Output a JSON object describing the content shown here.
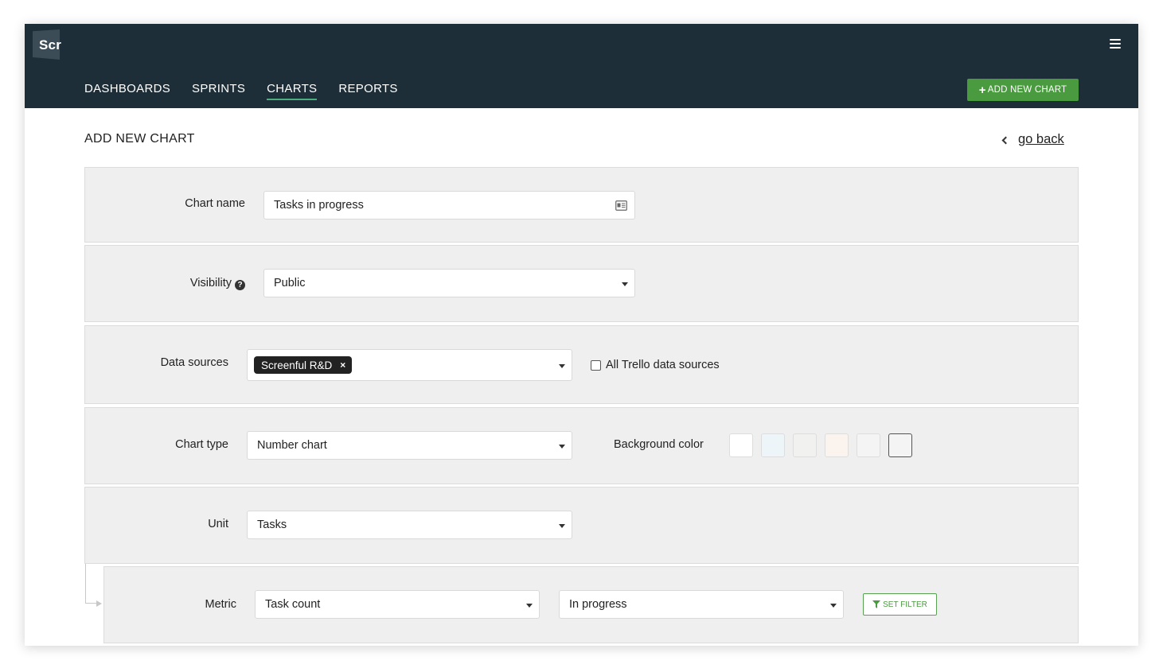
{
  "app": {
    "logo_text": "Scr"
  },
  "nav": {
    "items": [
      {
        "label": "DASHBOARDS",
        "active": false
      },
      {
        "label": "SPRINTS",
        "active": false
      },
      {
        "label": "CHARTS",
        "active": true
      },
      {
        "label": "REPORTS",
        "active": false
      }
    ],
    "add_button_label": "ADD NEW CHART"
  },
  "page": {
    "title": "ADD NEW CHART",
    "go_back_label": "go back"
  },
  "form": {
    "chart_name": {
      "label": "Chart name",
      "value": "Tasks in progress"
    },
    "visibility": {
      "label": "Visibility",
      "value": "Public",
      "help_glyph": "?"
    },
    "data_sources": {
      "label": "Data sources",
      "selected_tag": "Screenful R&D",
      "remove_glyph": "×",
      "all_trello_label": "All Trello data sources",
      "all_trello_checked": false
    },
    "chart_type": {
      "label": "Chart type",
      "value": "Number chart"
    },
    "background_color": {
      "label": "Background color",
      "swatches": [
        "#ffffff",
        "#eef5f8",
        "#f1f1ef",
        "#fbf3ee",
        "#f4f4f4",
        "#f4f4f4"
      ],
      "selected_index": 5
    },
    "unit": {
      "label": "Unit",
      "value": "Tasks"
    },
    "metric": {
      "label": "Metric",
      "value": "Task count",
      "status_value": "In progress",
      "filter_button_label": "SET FILTER"
    }
  },
  "colors": {
    "topbar": "#1e2e38",
    "accent_green": "#4a9a3f",
    "nav_underline": "#4cae7e",
    "row_background": "#efefef"
  }
}
